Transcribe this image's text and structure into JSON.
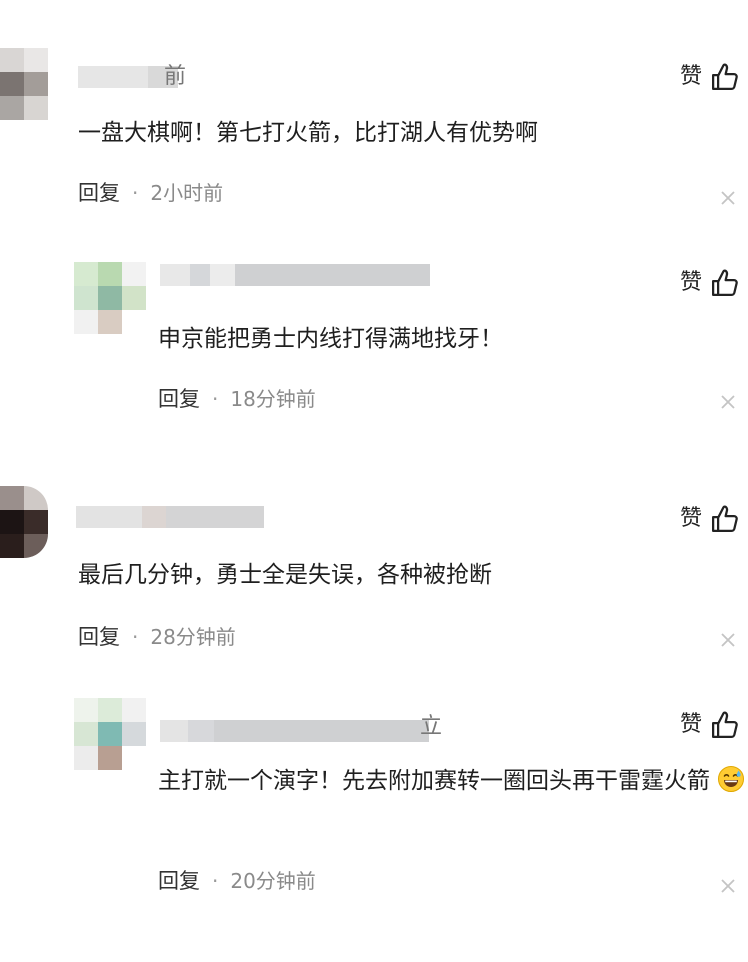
{
  "like_label": "赞",
  "reply_label": "回复",
  "meta_separator": "·",
  "comments": [
    {
      "name_tail": "前",
      "content": "一盘大棋啊！第七打火箭，比打湖人有优势啊",
      "time": "2小时前"
    },
    {
      "name_tail": "",
      "content": "申京能把勇士内线打得满地找牙！",
      "time": "18分钟前"
    },
    {
      "name_tail": "",
      "content": "最后几分钟，勇士全是失误，各种被抢断",
      "time": "28分钟前"
    },
    {
      "name_tail": "立",
      "content": "主打就一个演字！先去附加赛转一圈回头再干雷霆火箭",
      "emoji": "grinning-sweat-emoji",
      "time": "20分钟前"
    }
  ]
}
